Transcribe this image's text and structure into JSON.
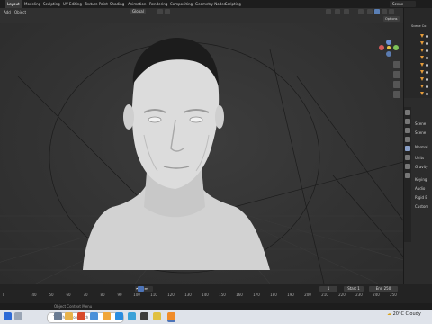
{
  "topbar": {
    "tabs": [
      "Layout",
      "Modeling",
      "Sculpting",
      "UV Editing",
      "Texture Paint",
      "Shading",
      "Animation",
      "Rendering",
      "Compositing",
      "Geometry Nodes",
      "Scripting"
    ],
    "active_tab": "Layout",
    "scene": "Scene"
  },
  "header": {
    "menus": [
      "Add",
      "Object"
    ],
    "transform_orientation": "Global",
    "options_label": "Options"
  },
  "outliner": {
    "collection_label": "Scene Co"
  },
  "properties": {
    "scene_label": "Scene",
    "sections": [
      "Scene",
      "Normal",
      "Units",
      "Gravity",
      "Keying",
      "Audio",
      "Rigid B",
      "Custom"
    ]
  },
  "timeline": {
    "frame_numbers": [
      "0",
      "40",
      "50",
      "60",
      "70",
      "80",
      "90",
      "100",
      "110",
      "120",
      "130",
      "140",
      "150",
      "160",
      "170",
      "180",
      "190",
      "200",
      "210",
      "220",
      "230",
      "240",
      "250"
    ],
    "current_frame": "1",
    "start_label": "Start",
    "start_value": "1",
    "end_label": "End",
    "end_value": "250"
  },
  "statusbar": {
    "hint": "Object Context Menu"
  },
  "taskbar": {
    "search_placeholder": "Type here to search",
    "weather": "20°C  Cloudy",
    "colors": {
      "accent": "#4d74b8"
    }
  }
}
